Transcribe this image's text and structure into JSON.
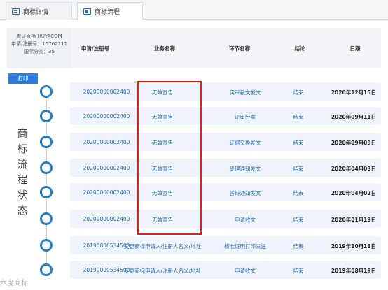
{
  "tabs": [
    {
      "label": "商标详情",
      "icon": "document-icon"
    },
    {
      "label": "商标流程",
      "icon": "list-icon"
    }
  ],
  "info": {
    "name": "虎牙直播 HUYACOM",
    "reg_no": "申请/注册号：15762111",
    "class": "国际分类：35"
  },
  "columns": [
    "申请/注册号",
    "业务名称",
    "环节名称",
    "结论",
    "日期"
  ],
  "print_label": "打印",
  "side_title": [
    "商",
    "标",
    "流",
    "程",
    "状",
    "态"
  ],
  "rows": [
    {
      "reg": "20200000002400",
      "biz": "无效宣告",
      "step": "实审裁文发文",
      "result": "结束",
      "date": "2020年12月15日"
    },
    {
      "reg": "20200000002400",
      "biz": "无效宣告",
      "step": "评审分案",
      "result": "结束",
      "date": "2020年09月11日"
    },
    {
      "reg": "20200000002400",
      "biz": "无效宣告",
      "step": "证据交换发文",
      "result": "结束",
      "date": "2020年09月09日"
    },
    {
      "reg": "20200000002400",
      "biz": "无效宣告",
      "step": "受理通知发文",
      "result": "结束",
      "date": "2020年04月03日"
    },
    {
      "reg": "20200000002400",
      "biz": "无效宣告",
      "step": "答辩通知发文",
      "result": "结束",
      "date": "2020年04月02日"
    },
    {
      "reg": "20200000002400",
      "biz": "无效宣告",
      "step": "申请收文",
      "result": "结束",
      "date": "2020年01月19日"
    },
    {
      "reg": "20190000534500",
      "biz": "变更商标申请人/注册人名义/地址",
      "step": "核准证明打印发送",
      "result": "结束",
      "date": "2019年10月18日"
    },
    {
      "reg": "20190000534500",
      "biz": "变更商标申请人/注册人名义/地址",
      "step": "申请收文",
      "result": "结束",
      "date": "2019年08月19日"
    }
  ],
  "watermark": "六度商标",
  "colors": {
    "accent": "#2b6cb0",
    "highlight": "#e0201b",
    "print": "#2d7ddc"
  }
}
